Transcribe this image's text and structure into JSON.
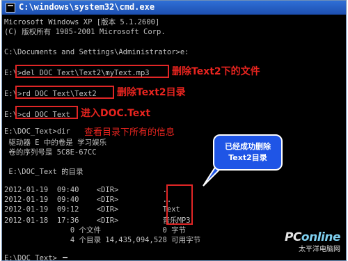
{
  "window": {
    "title": "C:\\windows\\system32\\cmd.exe"
  },
  "console": {
    "lines": [
      "Microsoft Windows XP [版本 5.1.2600]",
      "(C) 版权所有 1985-2001 Microsoft Corp.",
      "",
      "C:\\Documents and Settings\\Administrator>e:",
      "",
      "E:\\>del DOC_Text\\Text2\\myText.mp3",
      "",
      "E:\\>rd DOC_Text\\Text2",
      "",
      "E:\\>cd DOC_Text",
      "",
      "E:\\DOC_Text>dir",
      " 驱动器 E 中的卷是 学习娱乐",
      " 卷的序列号是 5C8E-67CC",
      "",
      " E:\\DOC_Text 的目录",
      "",
      "2012-01-19  09:40    <DIR>          .",
      "2012-01-19  09:40    <DIR>          ..",
      "2012-01-19  09:12    <DIR>          Text",
      "2012-01-18  17:36    <DIR>          音乐MP3",
      "               0 个文件              0 字节",
      "               4 个目录 14,435,094,528 可用字节",
      "",
      "E:\\DOC_Text>"
    ]
  },
  "annotations": {
    "del_note": "删除Text2下的文件",
    "rd_note": "删除Text2目录",
    "cd_note": "进入DOC.Text",
    "dir_note": "查看目录下所有的信息",
    "callout_line1": "已经成功删除",
    "callout_line2": "Text2目录"
  },
  "watermark": {
    "brand_left": "PC",
    "brand_right": "online",
    "subtitle": "太平洋电脑网"
  },
  "colors": {
    "console_bg": "#000000",
    "console_text": "#c0c0c0",
    "title_bar": "#2f6fd6",
    "annotation_red": "#e8241f",
    "callout_blue": "#1f55e6"
  }
}
